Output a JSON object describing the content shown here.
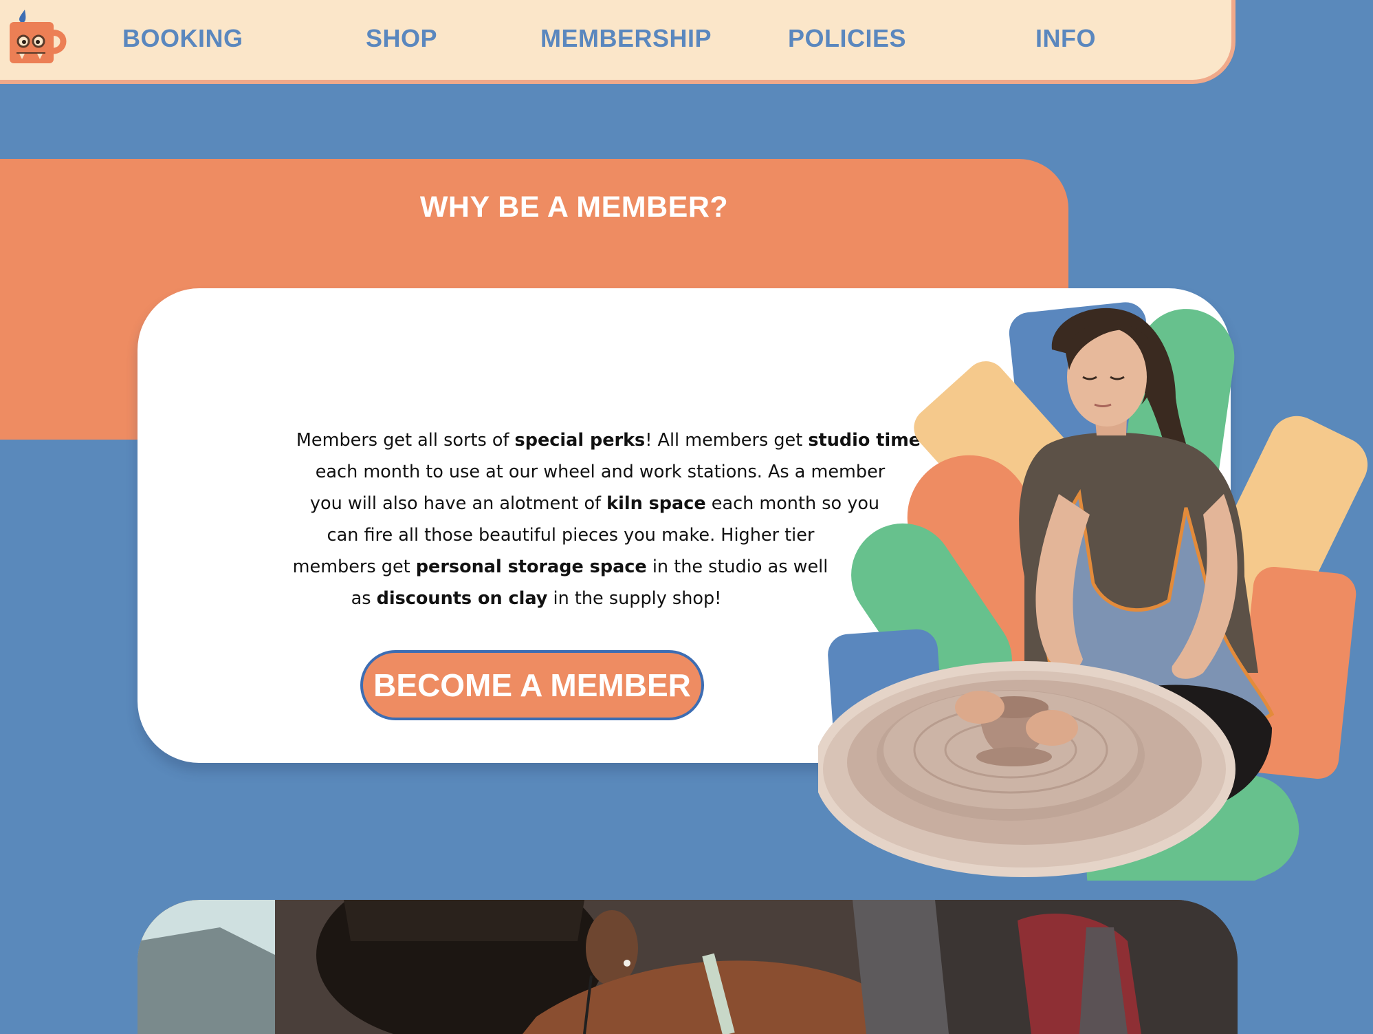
{
  "brand": {
    "logo_icon": "mug-monster-icon",
    "colors": {
      "page_background": "#5a89bb",
      "nav_background": "#fbe6c9",
      "nav_border": "#f0a98a",
      "nav_link": "#5a87be",
      "accent_orange": "#ee8c62",
      "button_border": "#3d6db3",
      "card": "#ffffff"
    }
  },
  "nav": {
    "items": [
      {
        "label": "BOOKING"
      },
      {
        "label": "SHOP"
      },
      {
        "label": "MEMBERSHIP"
      },
      {
        "label": "POLICIES"
      },
      {
        "label": "INFO"
      }
    ]
  },
  "membership": {
    "title": "WHY BE A MEMBER?",
    "body": {
      "t1": "Members get all sorts of ",
      "b1": "special perks",
      "t2": "! All members get ",
      "b2": "studio time",
      "t3": "each month to use at our wheel and work stations. As a member",
      "t4": "you will also have an alotment of ",
      "b3": "kiln space",
      "t5": " each month so you",
      "t6": "can fire all those beautiful pieces you make. Higher tier",
      "t7": "members get ",
      "b4": "personal storage space",
      "t8": " in the studio as well",
      "t9": "as ",
      "b5": "discounts on clay",
      "t10": " in the supply shop!"
    },
    "cta_label": "BECOME A MEMBER"
  }
}
